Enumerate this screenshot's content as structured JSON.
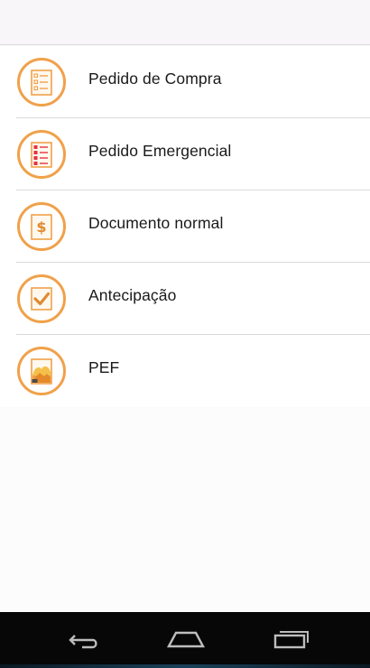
{
  "menu": {
    "items": [
      {
        "label": "Pedido de Compra",
        "icon": "order-checklist-icon"
      },
      {
        "label": "Pedido Emergencial",
        "icon": "emergency-list-icon"
      },
      {
        "label": "Documento normal",
        "icon": "dollar-document-icon"
      },
      {
        "label": "Antecipação",
        "icon": "checkmark-document-icon"
      },
      {
        "label": "PEF",
        "icon": "photo-document-icon"
      }
    ]
  },
  "navbar": {
    "buttons": [
      "back-icon",
      "home-icon",
      "recent-apps-icon"
    ]
  },
  "colors": {
    "accent_orange": "#f0a14a",
    "emergency_red": "#e5323f",
    "navbar_bg": "#070707"
  }
}
